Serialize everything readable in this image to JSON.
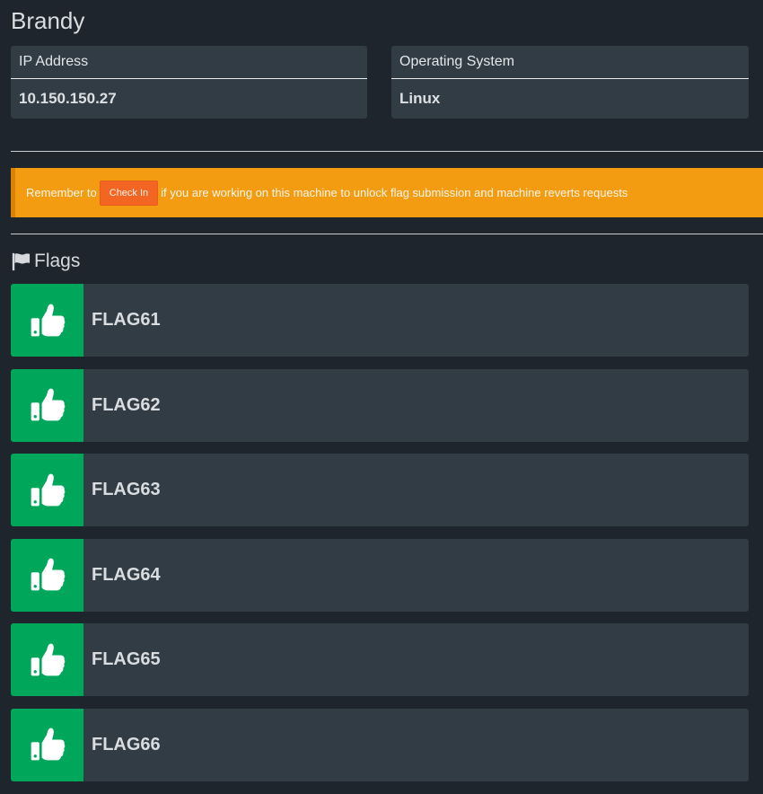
{
  "machine": {
    "name": "Brandy"
  },
  "info": {
    "ip_label": "IP Address",
    "ip_value": "10.150.150.27",
    "os_label": "Operating System",
    "os_value": "Linux"
  },
  "alert": {
    "prefix": "Remember to",
    "button_label": "Check In",
    "suffix": "if you are working on this machine to unlock flag submission and machine reverts requests"
  },
  "flags": {
    "heading": "Flags",
    "icon": "flag-icon",
    "status_icon": "thumbs-up-icon",
    "items": [
      {
        "name": "FLAG61"
      },
      {
        "name": "FLAG62"
      },
      {
        "name": "FLAG63"
      },
      {
        "name": "FLAG64"
      },
      {
        "name": "FLAG65"
      },
      {
        "name": "FLAG66"
      }
    ]
  },
  "colors": {
    "background": "#1e252d",
    "card": "#313c44",
    "alert": "#f39c12",
    "checkin_button": "#f26522",
    "success": "#00a65a"
  }
}
